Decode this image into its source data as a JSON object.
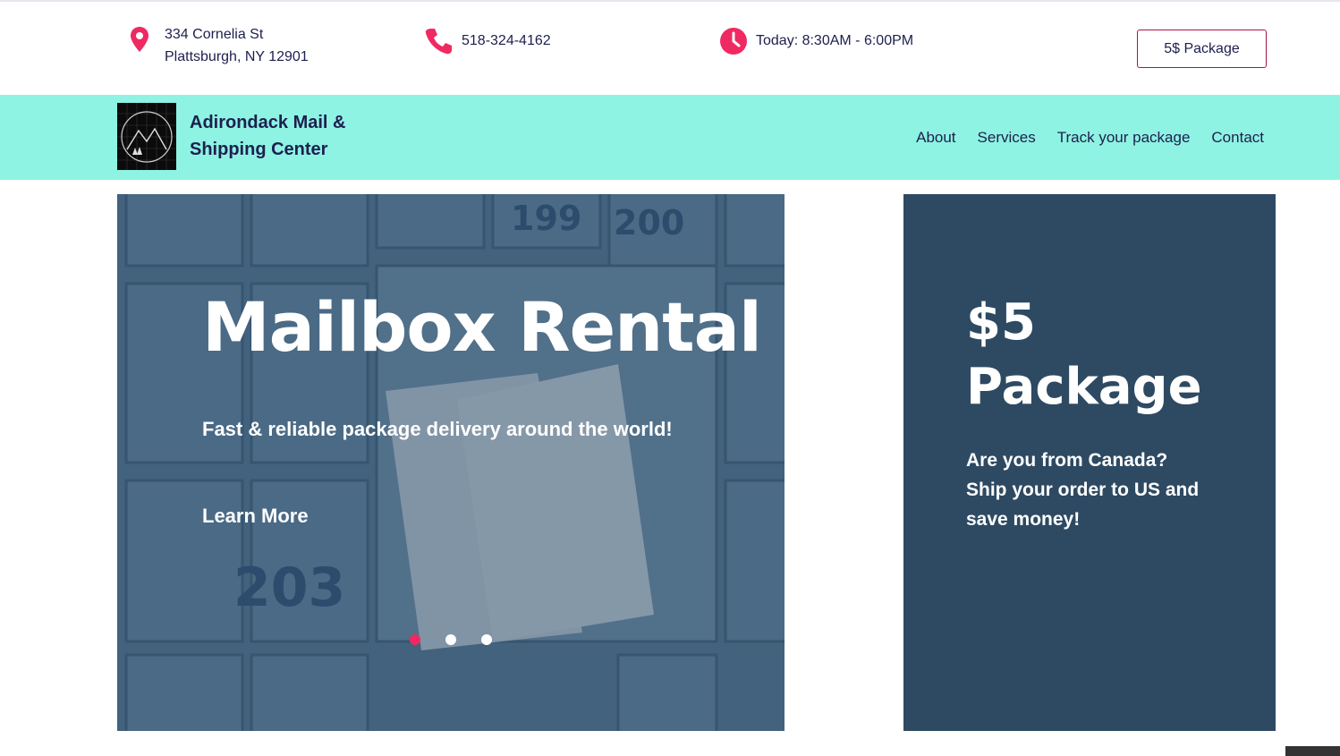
{
  "topbar": {
    "address_line1": "334 Cornelia St",
    "address_line2": "Plattsburgh, NY 12901",
    "phone": "518-324-4162",
    "hours": "Today: 8:30AM - 6:00PM",
    "package_button": "5$ Package"
  },
  "navbar": {
    "brand_line1": "Adirondack Mail &",
    "brand_line2": "Shipping Center",
    "links": [
      "About",
      "Services",
      "Track your package",
      "Contact"
    ]
  },
  "hero": {
    "title": "Mailbox Rental",
    "subtitle": "Fast & reliable package delivery around the world!",
    "cta": "Learn More",
    "mailbox_numbers": [
      "199",
      "200",
      "203"
    ],
    "active_slide": 1,
    "slide_count": 3
  },
  "promo": {
    "title_line1": "$5",
    "title_line2": "Package",
    "text_line1": "Are you from Canada?",
    "text_line2": "Ship your order to US and",
    "text_line3": "save money!"
  },
  "colors": {
    "accent": "#ef2a63",
    "nav_bg": "#8ef3e2",
    "text_dark": "#1d1f4f",
    "promo_bg": "#2e4a62",
    "button_border": "#a7154a"
  },
  "icons": [
    "location-pin-icon",
    "phone-icon",
    "clock-icon"
  ]
}
